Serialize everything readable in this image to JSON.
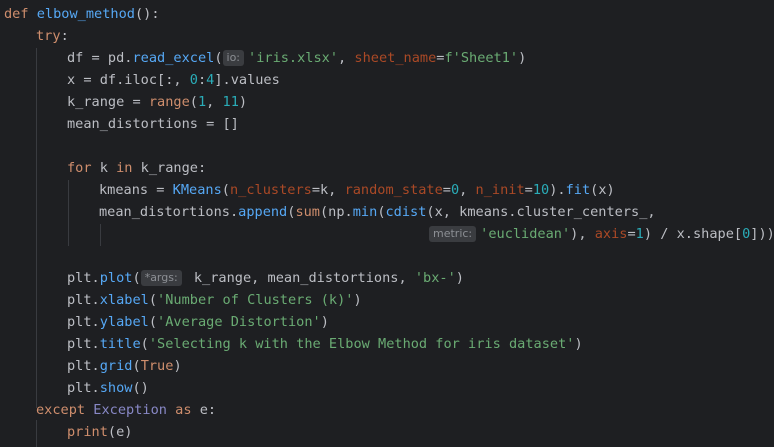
{
  "code": {
    "l1": {
      "def": "def",
      "name": "elbow_method",
      "rest": "():"
    },
    "l2": {
      "try": "try",
      "colon": ":"
    },
    "l3": {
      "a": "df = pd.",
      "fn": "read_excel",
      "b": "(",
      "hint": "io:",
      "s1": "'iris.xlsx'",
      "c": ", ",
      "p": "sheet_name",
      "d": "=",
      "s2": "f'Sheet1'",
      "e": ")"
    },
    "l4": {
      "a": "x = df.iloc[:, ",
      "n1": "0",
      "b": ":",
      "n2": "4",
      "c": "].values"
    },
    "l5": {
      "a": "k_range = ",
      "fn": "range",
      "b": "(",
      "n1": "1",
      "c": ", ",
      "n2": "11",
      "d": ")"
    },
    "l6": {
      "a": "mean_distortions = []"
    },
    "l8": {
      "for": "for",
      "a": " k ",
      "in": "in",
      "b": " k_range:"
    },
    "l9": {
      "a": "kmeans = ",
      "cls": "KMeans",
      "b": "(",
      "p1": "n_clusters",
      "c": "=k, ",
      "p2": "random_state",
      "d": "=",
      "n1": "0",
      "e": ", ",
      "p3": "n_init",
      "f": "=",
      "n2": "10",
      "g": ").",
      "fn": "fit",
      "h": "(x)"
    },
    "l10": {
      "a": "mean_distortions.",
      "fn1": "append",
      "b": "(",
      "fn2": "sum",
      "c": "(np.",
      "fn3": "min",
      "d": "(",
      "fn4": "cdist",
      "e": "(x, kmeans.cluster_centers_,"
    },
    "l11": {
      "hint": "metric:",
      "s": "'euclidean'",
      "a": "), ",
      "p": "axis",
      "b": "=",
      "n": "1",
      "c": ") / x.shape[",
      "n2": "0",
      "d": "]))"
    },
    "l13": {
      "a": "plt.",
      "fn": "plot",
      "b": "(",
      "hint": "*args:",
      "c": " k_range, mean_distortions, ",
      "s": "'bx-'",
      "d": ")"
    },
    "l14": {
      "a": "plt.",
      "fn": "xlabel",
      "b": "(",
      "s": "'Number of Clusters (k)'",
      "c": ")"
    },
    "l15": {
      "a": "plt.",
      "fn": "ylabel",
      "b": "(",
      "s": "'Average Distortion'",
      "c": ")"
    },
    "l16": {
      "a": "plt.",
      "fn": "title",
      "b": "(",
      "s": "'Selecting k with the Elbow Method for iris dataset'",
      "c": ")"
    },
    "l17": {
      "a": "plt.",
      "fn": "grid",
      "b": "(",
      "kw": "True",
      "c": ")"
    },
    "l18": {
      "a": "plt.",
      "fn": "show",
      "b": "()"
    },
    "l19": {
      "except": "except",
      "sp": " ",
      "cls": "Exception",
      "sp2": " ",
      "as": "as",
      "b": " e:"
    },
    "l20": {
      "fn": "print",
      "b": "(e)"
    }
  },
  "colors": {
    "background": "#1e1f22",
    "keyword": "#cf8e6d",
    "function": "#56a8f5",
    "string": "#6aab73",
    "number": "#2aacb8",
    "parameter": "#aa4926"
  }
}
